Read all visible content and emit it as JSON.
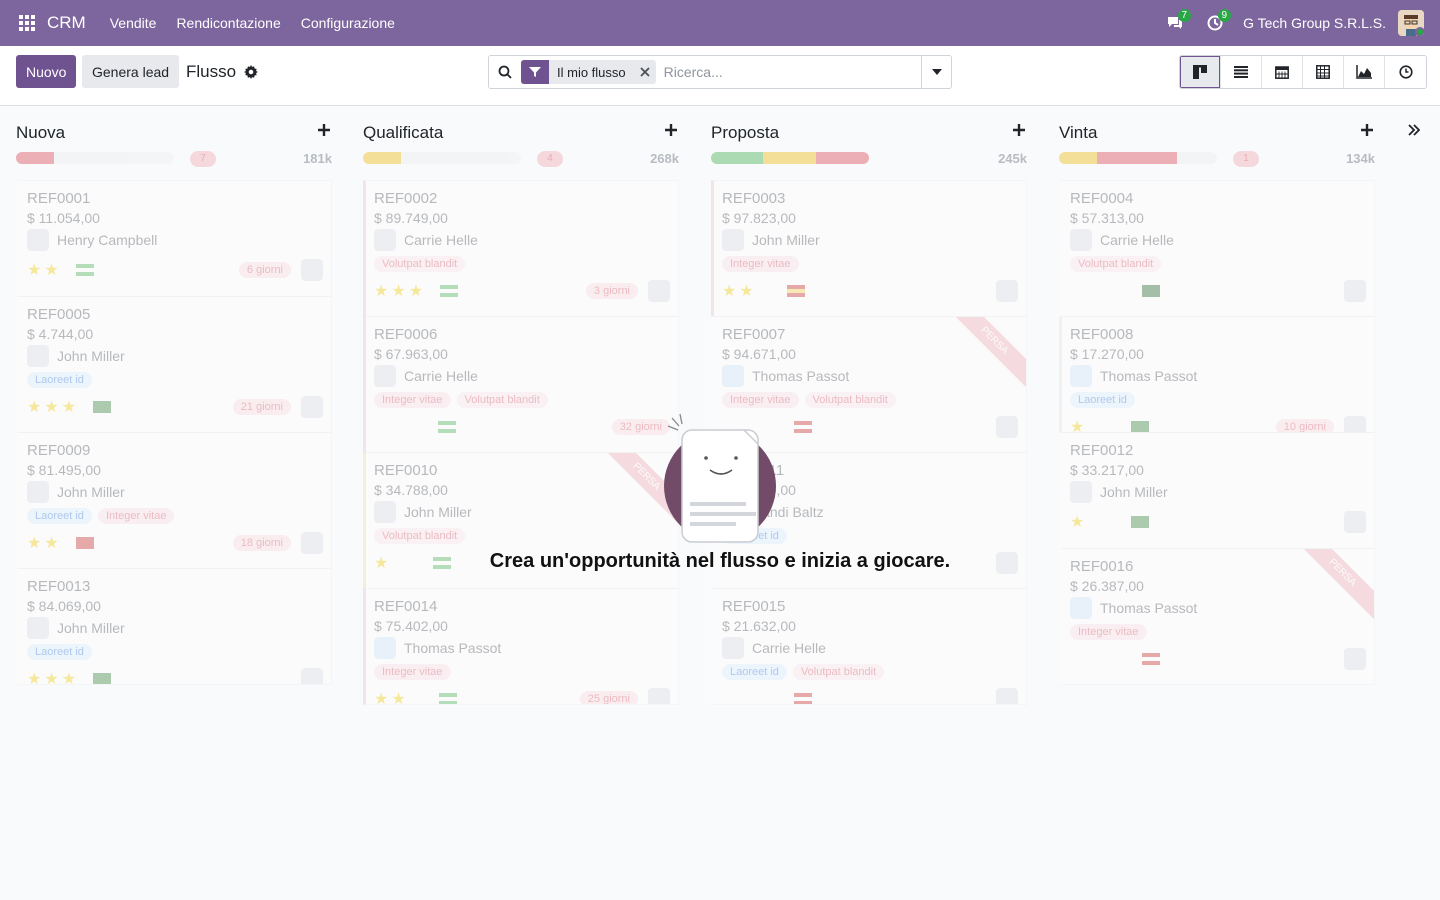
{
  "navbar": {
    "brand": "CRM",
    "menu": [
      "Vendite",
      "Rendicontazione",
      "Configurazione"
    ],
    "messages_badge": "7",
    "activities_badge": "9",
    "company": "G Tech Group S.R.L.S."
  },
  "control": {
    "new_label": "Nuovo",
    "generate_label": "Genera lead",
    "breadcrumb": "Flusso",
    "facet_label": "Il mio flusso",
    "search_placeholder": "Ricerca..."
  },
  "columns": [
    {
      "title": "Nuova",
      "count": "7",
      "total": "181k",
      "cards": [
        {
          "ref": "REF0001",
          "amount": "$ 11.054,00",
          "person": "Henry Campbell",
          "tags": [],
          "stars": "★★",
          "days": "6 giorni"
        },
        {
          "ref": "REF0005",
          "amount": "$ 4.744,00",
          "person": "John Miller",
          "tags": [
            "Laoreet id"
          ],
          "stars": "★★★",
          "days": "21 giorni"
        },
        {
          "ref": "REF0009",
          "amount": "$ 81.495,00",
          "person": "John Miller",
          "tags": [
            "Laoreet id",
            "Integer vitae"
          ],
          "stars": "★★",
          "days": "18 giorni"
        },
        {
          "ref": "REF0013",
          "amount": "$ 84.069,00",
          "person": "John Miller",
          "tags": [
            "Laoreet id"
          ],
          "stars": "★★★",
          "days": ""
        }
      ]
    },
    {
      "title": "Qualificata",
      "count": "4",
      "total": "268k",
      "cards": [
        {
          "ref": "REF0002",
          "amount": "$ 89.749,00",
          "person": "Carrie Helle",
          "tags": [
            "Volutpat blandit"
          ],
          "stars": "★★★",
          "days": "3 giorni"
        },
        {
          "ref": "REF0006",
          "amount": "$ 67.963,00",
          "person": "Carrie Helle",
          "tags": [
            "Integer vitae",
            "Volutpat blandit"
          ],
          "stars": "",
          "days": "32 giorni"
        },
        {
          "ref": "REF0010",
          "amount": "$ 34.788,00",
          "person": "John Miller",
          "tags": [
            "Volutpat blandit"
          ],
          "stars": "★",
          "days": ""
        },
        {
          "ref": "REF0014",
          "amount": "$ 75.402,00",
          "person": "Thomas Passot",
          "tags": [
            "Integer vitae"
          ],
          "stars": "★★",
          "days": "25 giorni"
        }
      ]
    },
    {
      "title": "Proposta",
      "count": "",
      "total": "245k",
      "cards": [
        {
          "ref": "REF0003",
          "amount": "$ 97.823,00",
          "person": "John Miller",
          "tags": [
            "Integer vitae"
          ],
          "stars": "★★",
          "days": ""
        },
        {
          "ref": "REF0007",
          "amount": "$ 94.671,00",
          "person": "Thomas Passot",
          "tags": [
            "Integer vitae",
            "Volutpat blandit"
          ],
          "stars": "",
          "days": ""
        },
        {
          "ref": "REF0011",
          "amount": "$ 52.519,00",
          "person": "Randi Baltz",
          "tags": [
            "Laoreet id"
          ],
          "stars": "",
          "days": ""
        },
        {
          "ref": "REF0015",
          "amount": "$ 21.632,00",
          "person": "Carrie Helle",
          "tags": [
            "Laoreet id",
            "Volutpat blandit"
          ],
          "stars": "",
          "days": ""
        }
      ]
    },
    {
      "title": "Vinta",
      "count": "1",
      "total": "134k",
      "cards": [
        {
          "ref": "REF0004",
          "amount": "$ 57.313,00",
          "person": "Carrie Helle",
          "tags": [
            "Volutpat blandit"
          ],
          "stars": "",
          "days": ""
        },
        {
          "ref": "REF0008",
          "amount": "$ 17.270,00",
          "person": "Thomas Passot",
          "tags": [
            "Laoreet id"
          ],
          "stars": "★",
          "days": "10 giorni"
        },
        {
          "ref": "REF0012",
          "amount": "$ 33.217,00",
          "person": "John Miller",
          "tags": [],
          "stars": "★",
          "days": ""
        },
        {
          "ref": "REF0016",
          "amount": "$ 26.387,00",
          "person": "Thomas Passot",
          "tags": [
            "Integer vitae"
          ],
          "stars": "",
          "days": ""
        }
      ]
    }
  ],
  "lost_ribbon": "PERSA",
  "helper_text": "Crea un'opportunità nel flusso e inizia a giocare.",
  "colors": {
    "navbar": "#7d659e",
    "primary": "#6f5391",
    "badge_green": "#28a745"
  }
}
